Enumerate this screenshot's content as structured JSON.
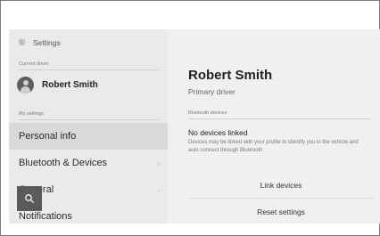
{
  "sidebar": {
    "header": {
      "label": "Settings",
      "icon": "gear-icon"
    },
    "current_driver_label": "Current driver",
    "current_driver": {
      "name": "Robert Smith",
      "icon": "person-icon"
    },
    "my_settings_label": "My settings",
    "items": [
      {
        "label": "Personal info",
        "active": true,
        "chevron": ""
      },
      {
        "label": "Bluetooth & Devices",
        "active": false,
        "chevron": "›"
      },
      {
        "label": "General",
        "active": false,
        "chevron": "›"
      },
      {
        "label": "Notifications",
        "active": false,
        "chevron": ""
      }
    ]
  },
  "search_fab": {
    "icon": "search-icon"
  },
  "main": {
    "name": "Robert Smith",
    "role": "Primary driver",
    "bluetooth_section_label": "Bluetooth devices",
    "no_devices_title": "No devices linked",
    "no_devices_desc": "Devices may be linked with your profile to identify you in the vehicle and auto connect through Bluetooth",
    "link_devices_label": "Link devices",
    "reset_settings_label": "Reset settings"
  }
}
